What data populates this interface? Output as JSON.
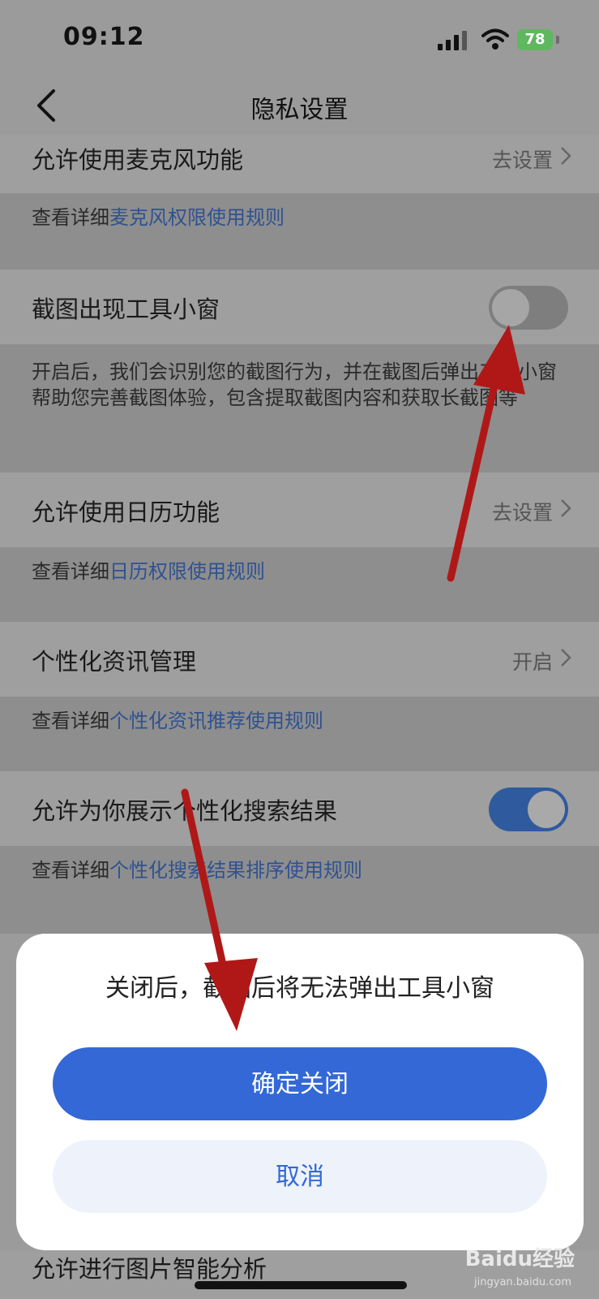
{
  "status_bar": {
    "time": "09:12",
    "battery": "78"
  },
  "nav": {
    "title": "隐私设置"
  },
  "rows": {
    "microphone": {
      "label": "允许使用麦克风功能",
      "right": "去设置"
    },
    "microphone_desc": {
      "prefix": "查看详细",
      "link": "麦克风权限使用规则"
    },
    "screenshot_tool": {
      "label": "截图出现工具小窗",
      "toggle": "off"
    },
    "screenshot_desc": {
      "text": "开启后，我们会识别您的截图行为，并在截图后弹出工具小窗帮助您完善截图体验，包含提取截图内容和获取长截图等"
    },
    "calendar": {
      "label": "允许使用日历功能",
      "right": "去设置"
    },
    "calendar_desc": {
      "prefix": "查看详细",
      "link": "日历权限使用规则"
    },
    "news": {
      "label": "个性化资讯管理",
      "right": "开启"
    },
    "news_desc": {
      "prefix": "查看详细",
      "link": "个性化资讯推荐使用规则"
    },
    "search": {
      "label": "允许为你展示个性化搜索结果",
      "toggle": "on"
    },
    "search_desc": {
      "prefix": "查看详细",
      "link": "个性化搜索结果排序使用规则"
    },
    "image_analysis": {
      "label": "允许进行图片智能分析"
    }
  },
  "dialog": {
    "message": "关闭后，截图后将无法弹出工具小窗",
    "confirm_label": "确定关闭",
    "cancel_label": "取消"
  },
  "watermark": {
    "brand": "Baidu经验",
    "url": "jingyan.baidu.com"
  },
  "colors": {
    "accent": "#3368d6",
    "link": "#2f5290",
    "arrow": "#b01818"
  }
}
